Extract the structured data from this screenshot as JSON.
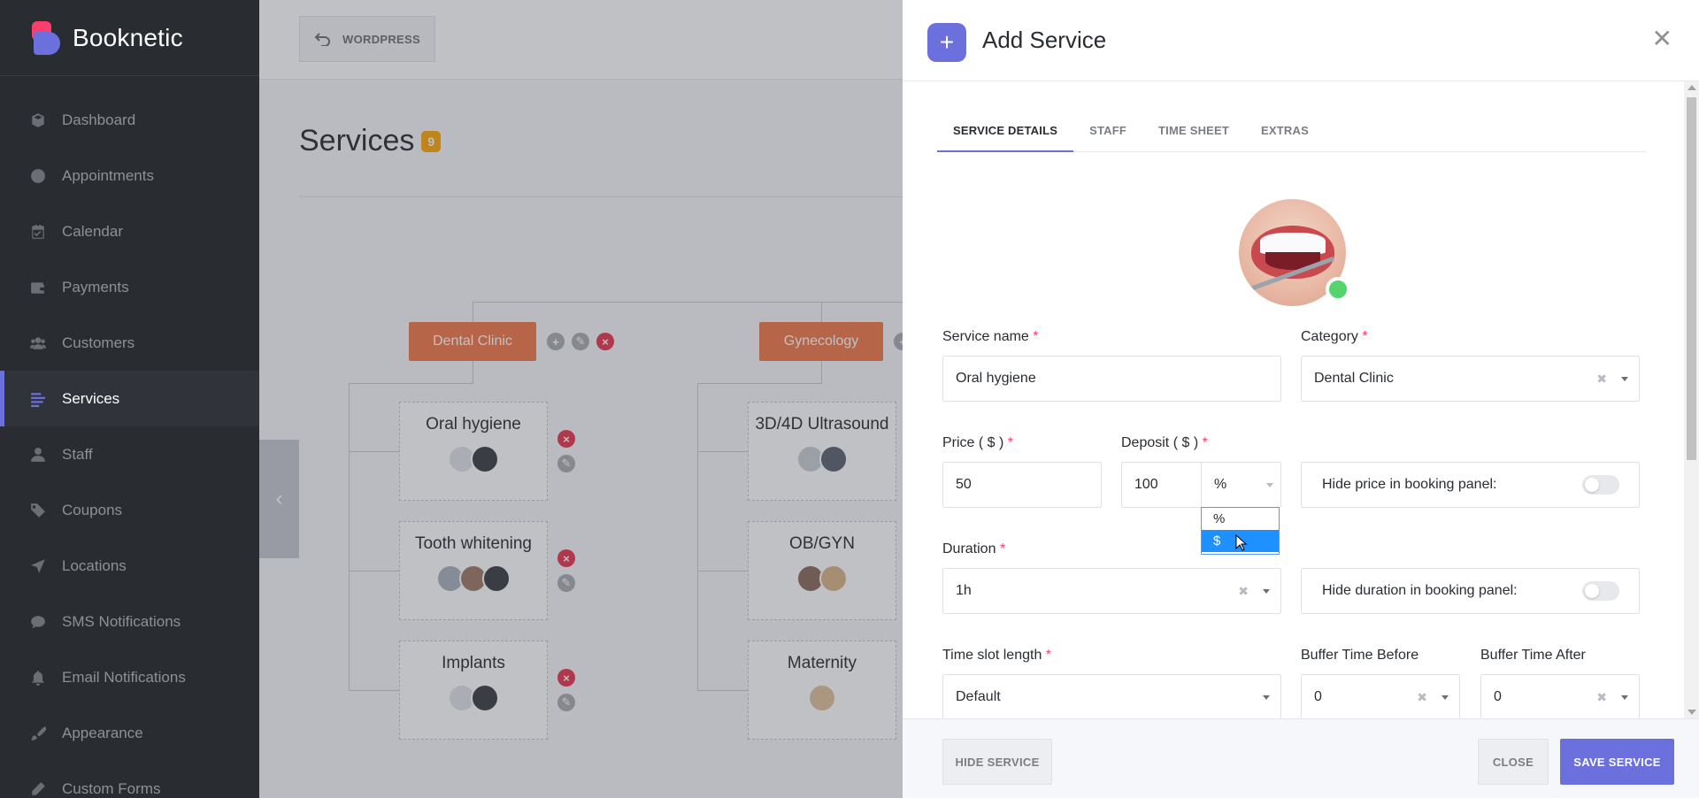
{
  "app": {
    "name": "Booknetic"
  },
  "sidebar": {
    "items": [
      {
        "label": "Dashboard",
        "icon": "cube-icon"
      },
      {
        "label": "Appointments",
        "icon": "clock-icon"
      },
      {
        "label": "Calendar",
        "icon": "calendar-icon"
      },
      {
        "label": "Payments",
        "icon": "wallet-icon"
      },
      {
        "label": "Customers",
        "icon": "users-icon"
      },
      {
        "label": "Services",
        "icon": "list-icon",
        "active": true
      },
      {
        "label": "Staff",
        "icon": "user-icon"
      },
      {
        "label": "Coupons",
        "icon": "tag-icon"
      },
      {
        "label": "Locations",
        "icon": "location-arrow-icon"
      },
      {
        "label": "SMS Notifications",
        "icon": "chat-icon"
      },
      {
        "label": "Email Notifications",
        "icon": "bell-icon"
      },
      {
        "label": "Appearance",
        "icon": "brush-icon"
      },
      {
        "label": "Custom Forms",
        "icon": "pencil-icon"
      }
    ]
  },
  "topbar": {
    "wordpress_label": "WORDPRESS"
  },
  "page": {
    "title": "Services",
    "count": "9"
  },
  "categories": [
    {
      "name": "Dental Clinic",
      "services": [
        {
          "name": "Oral hygiene"
        },
        {
          "name": "Tooth whitening"
        },
        {
          "name": "Implants"
        }
      ]
    },
    {
      "name": "Gynecology",
      "services": [
        {
          "name": "3D/4D Ultrasound"
        },
        {
          "name": "OB/GYN"
        },
        {
          "name": "Maternity"
        }
      ]
    }
  ],
  "modal": {
    "title": "Add Service",
    "close_glyph": "✕",
    "tabs": [
      "SERVICE DETAILS",
      "STAFF",
      "TIME SHEET",
      "EXTRAS"
    ],
    "form": {
      "service_name": {
        "label": "Service name",
        "value": "Oral hygiene"
      },
      "category": {
        "label": "Category",
        "value": "Dental Clinic"
      },
      "price": {
        "label": "Price ( $ )",
        "value": "50"
      },
      "deposit": {
        "label": "Deposit ( $ )",
        "value": "100",
        "type_value": "%",
        "options": [
          "%",
          "$"
        ],
        "highlighted": "$"
      },
      "hide_price": {
        "label": "Hide price in booking panel:",
        "on": false
      },
      "duration": {
        "label": "Duration",
        "value": "1h"
      },
      "hide_duration": {
        "label": "Hide duration in booking panel:",
        "on": false
      },
      "time_slot": {
        "label": "Time slot length",
        "value": "Default"
      },
      "buffer_before": {
        "label": "Buffer Time Before",
        "value": "0"
      },
      "buffer_after": {
        "label": "Buffer Time After",
        "value": "0"
      },
      "required_mark": "*"
    },
    "footer": {
      "hide_label": "HIDE SERVICE",
      "close_label": "CLOSE",
      "save_label": "SAVE SERVICE"
    }
  },
  "colors": {
    "accent": "#6c70dc",
    "sidebar_bg": "#292d32",
    "category": "#f2784b",
    "badge": "#fea705",
    "danger": "#e8344e",
    "selected_option": "#1e90ff",
    "status_active": "#53d56c"
  }
}
